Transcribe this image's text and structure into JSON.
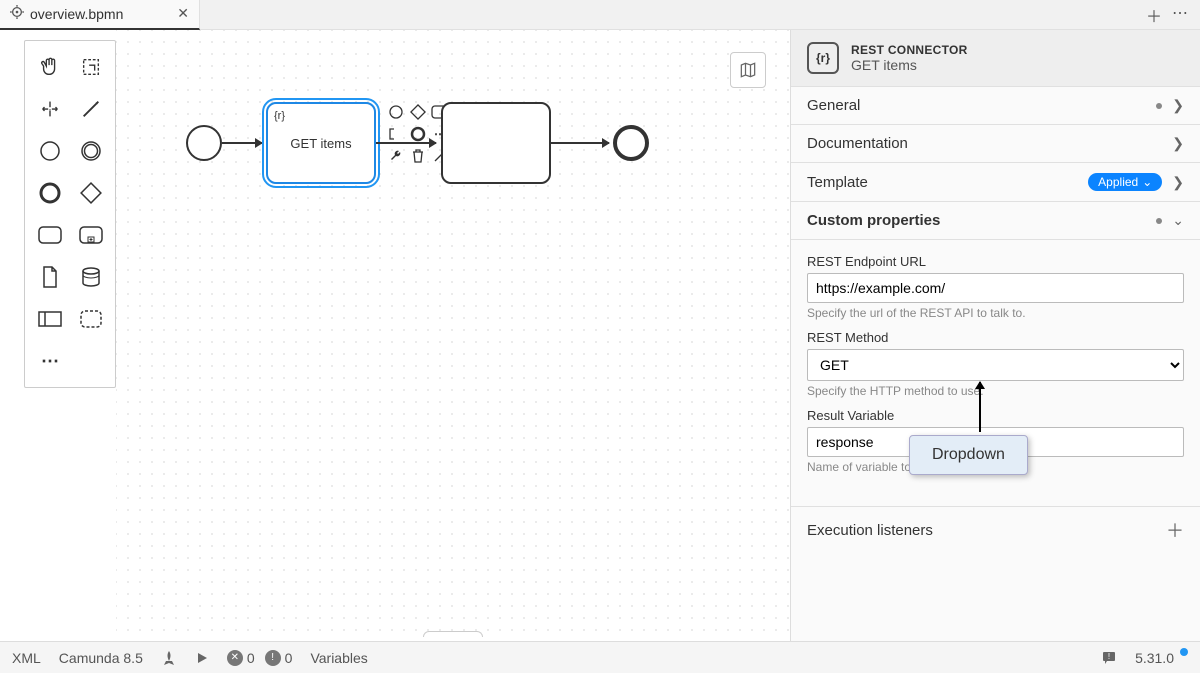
{
  "tabs": {
    "file": "overview.bpmn"
  },
  "canvas": {
    "task_label": "GET items"
  },
  "panel": {
    "header_title": "REST CONNECTOR",
    "header_subtitle": "GET items",
    "sections": {
      "general": "General",
      "documentation": "Documentation",
      "template": "Template",
      "custom_props": "Custom properties",
      "execution_listeners": "Execution listeners"
    },
    "applied_label": "Applied",
    "fields": {
      "endpoint_label": "REST Endpoint URL",
      "endpoint_value": "https://example.com/",
      "endpoint_hint": "Specify the url of the REST API to talk to.",
      "method_label": "REST Method",
      "method_value": "GET",
      "method_hint": "Specify the HTTP method to use.",
      "result_label": "Result Variable",
      "result_value": "response",
      "result_hint": "Name of variable to"
    }
  },
  "callout": {
    "text": "Dropdown"
  },
  "status": {
    "xml": "XML",
    "camunda": "Camunda 8.5",
    "errors": "0",
    "warnings": "0",
    "variables": "Variables",
    "version": "5.31.0"
  }
}
